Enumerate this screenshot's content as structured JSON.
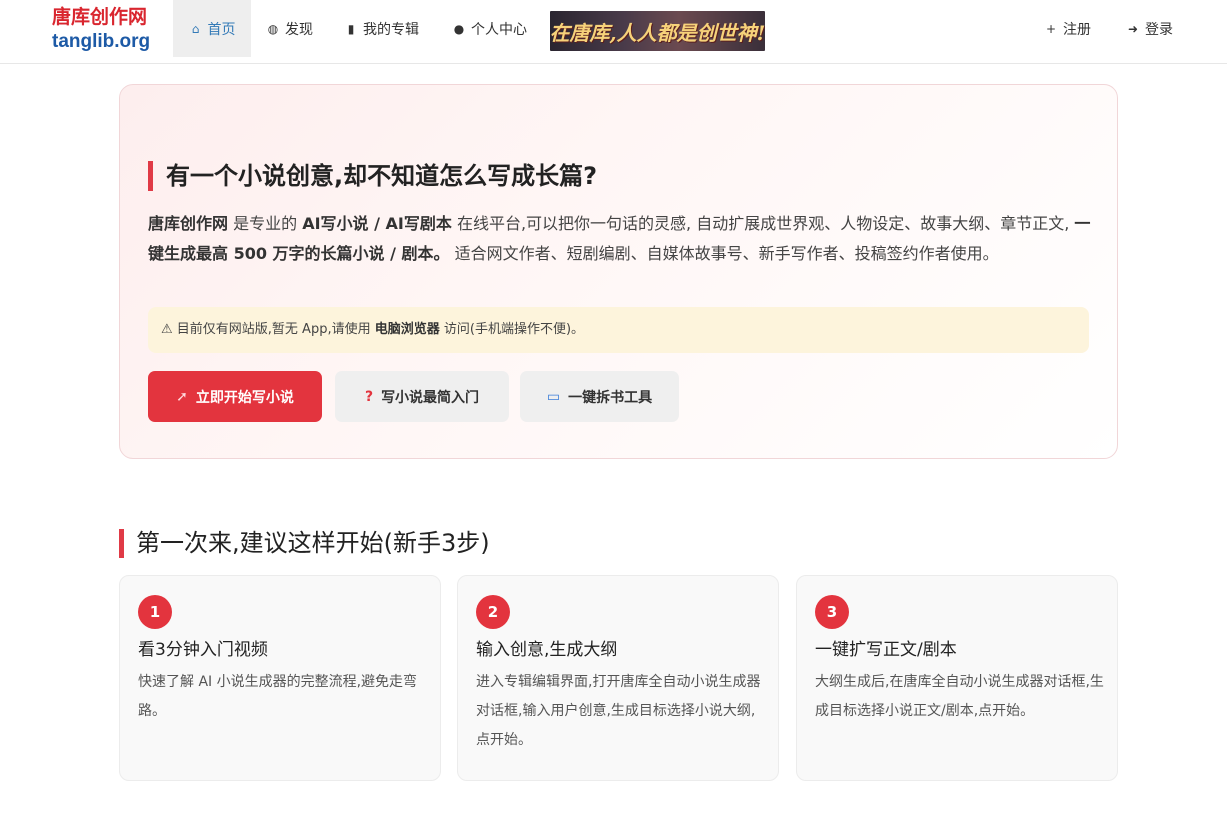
{
  "nav": {
    "logo_cn": "唐库创作网",
    "logo_en": "tanglib.org",
    "home": "首页",
    "discover": "发现",
    "my_albums": "我的专辑",
    "personal_center": "个人中心",
    "banner_text": "在唐库,人人都是创世神!",
    "register": "注册",
    "login": "登录"
  },
  "hero": {
    "title": "有一个小说创意,却不知道怎么写成长篇?",
    "desc_1": "唐库创作网",
    "desc_2": " 是专业的 ",
    "desc_3": "AI写小说 / AI写剧本",
    "desc_4": " 在线平台,可以把你一句话的灵感, 自动扩展成世界观、人物设定、故事大纲、章节正文, ",
    "desc_5": "一键生成最高 500 万字的长篇小说 / 剧本。",
    "desc_6": " 适合网文作者、短剧编剧、自媒体故事号、新手写作者、投稿签约作者使用。",
    "notice_1": "⚠ 目前仅有网站版,暂无 App,请使用 ",
    "notice_2": "电脑浏览器",
    "notice_3": " 访问(手机端操作不便)。",
    "btn_start": "立即开始写小说",
    "btn_intro": "写小说最简入门",
    "btn_tool": "一键拆书工具"
  },
  "steps": {
    "section_title": "第一次来,建议这样开始(新手3步)",
    "items": [
      {
        "num": "1",
        "title": "看3分钟入门视频",
        "desc": "快速了解 AI 小说生成器的完整流程,避免走弯路。"
      },
      {
        "num": "2",
        "title": "输入创意,生成大纲",
        "desc": "进入专辑编辑界面,打开唐库全自动小说生成器对话框,输入用户创意,生成目标选择小说大纲,点开始。"
      },
      {
        "num": "3",
        "title": "一键扩写正文/剧本",
        "desc": "大纲生成后,在唐库全自动小说生成器对话框,生成目标选择小说正文/剧本,点开始。"
      }
    ]
  },
  "colors": {
    "accent": "#e3343e",
    "nav_active": "#337ab7",
    "notice_bg": "#fdf4dc"
  }
}
